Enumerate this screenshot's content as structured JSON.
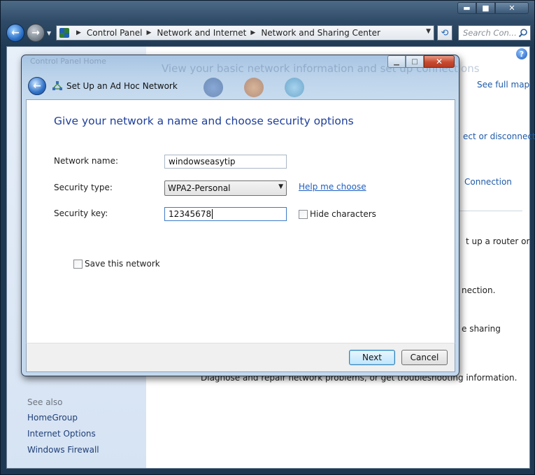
{
  "explorer": {
    "breadcrumbs": [
      "Control Panel",
      "Network and Internet",
      "Network and Sharing Center"
    ],
    "search_placeholder": "Search Con...",
    "min_glyph": "▬",
    "max_glyph": "■",
    "close_glyph": "✕"
  },
  "background": {
    "banner": "View your basic network information and set up connections",
    "see_full_map": "See full map",
    "connect_disconnect": "ect or disconnect",
    "connection": "Connection",
    "router_text": "t up a router or",
    "nection_text": "nection.",
    "sharing_text": "e sharing",
    "diagnose_text": "Diagnose and repair network problems, or get troubleshooting information.",
    "see_also": "See also",
    "see_also_links": [
      "HomeGroup",
      "Internet Options",
      "Windows Firewall"
    ]
  },
  "dialog": {
    "ghost_title": "Control Panel Home",
    "title": "Set Up an Ad Hoc Network",
    "heading": "Give your network a name and choose security options",
    "network_name_label": "Network name:",
    "network_name_value": "windowseasytip",
    "security_type_label": "Security type:",
    "security_type_value": "WPA2-Personal",
    "help_link": "Help me choose",
    "security_key_label": "Security key:",
    "security_key_value": "12345678",
    "hide_characters_label": "Hide characters",
    "save_network_label": "Save this network",
    "next_label": "Next",
    "cancel_label": "Cancel"
  }
}
